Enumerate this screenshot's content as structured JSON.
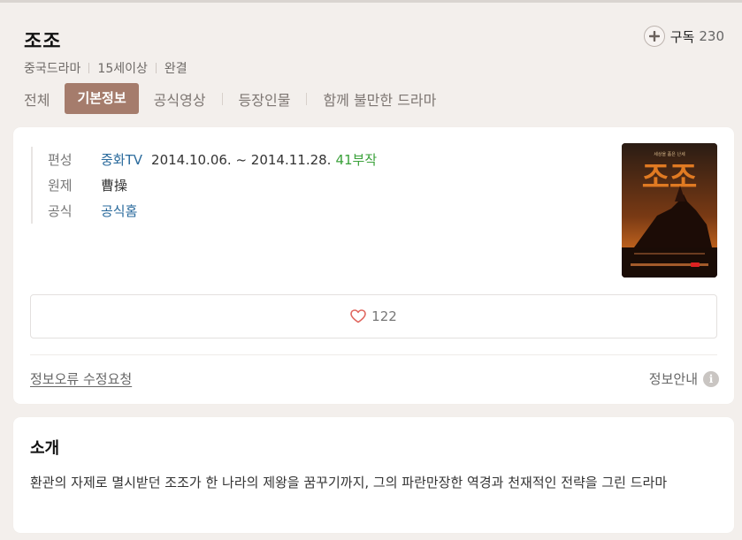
{
  "header": {
    "title": "조조",
    "subscribe": {
      "label": "구독",
      "count": "230"
    },
    "meta": [
      "중국드라마",
      "15세이상",
      "완결"
    ],
    "tabs": [
      {
        "label": "전체",
        "active": false
      },
      {
        "label": "기본정보",
        "active": true
      },
      {
        "label": "공식영상",
        "active": false
      },
      {
        "label": "등장인물",
        "active": false
      },
      {
        "label": "함께 불만한 드라마",
        "active": false
      }
    ]
  },
  "info": {
    "broadcast_label": "편성",
    "channel": "중화TV",
    "dates": "2014.10.06. ~ 2014.11.28.",
    "episodes": "41부작",
    "original_title_label": "원제",
    "original_title": "曹操",
    "official_label": "공식",
    "official_link": "공식홈",
    "poster": {
      "tagline": "세상을 품은 난세",
      "title": "조조"
    },
    "likes": "122",
    "report_link": "정보오류 수정요청",
    "info_guide": "정보안내",
    "info_icon": "i"
  },
  "intro": {
    "heading": "소개",
    "text": "환관의 자제로 멸시받던 조조가 한 나라의 제왕을 꿈꾸기까지, 그의 파란만장한 역경과 천재적인 전략을 그린 드라마"
  },
  "colors": {
    "background": "#f3efec",
    "active_tab": "#a57c6c",
    "link": "#2a6a9c",
    "episodes": "#3aa13a",
    "heart": "#e0675f"
  }
}
